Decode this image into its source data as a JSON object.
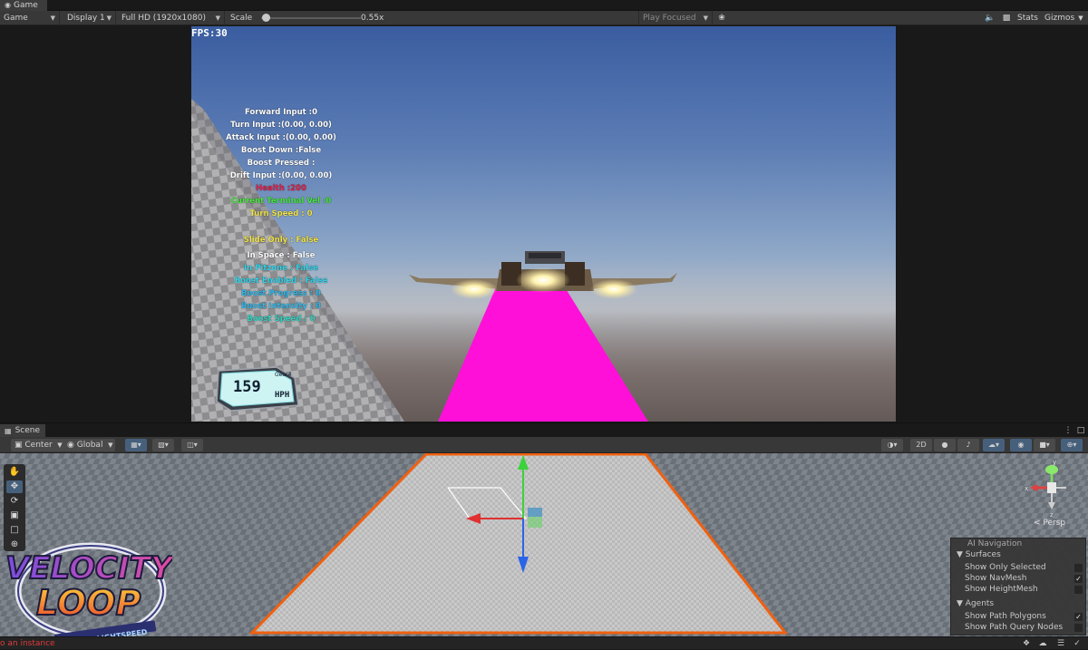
{
  "game_window": {
    "tab_label": "Game",
    "toolbar": {
      "mode": "Game",
      "display": "Display 1",
      "resolution": "Full HD (1920x1080)",
      "scale_label": "Scale",
      "scale_value": "0.55x",
      "scale_fraction": 0.05,
      "play_focused": "Play Focused",
      "stats": "Stats",
      "gizmos": "Gizmos"
    }
  },
  "hud": {
    "fps": "FPS:30",
    "lines": [
      {
        "text": "Forward Input :0",
        "color": "#ffffff"
      },
      {
        "text": "Turn Input :(0.00, 0.00)",
        "color": "#ffffff"
      },
      {
        "text": "Attack Input :(0.00, 0.00)",
        "color": "#ffffff"
      },
      {
        "text": "Boost Down :False",
        "color": "#ffffff"
      },
      {
        "text": "Boost Pressed :",
        "color": "#ffffff"
      },
      {
        "text": "Drift Input :(0.00, 0.00)",
        "color": "#ffffff"
      },
      {
        "text": "Health :200",
        "color": "#e0234a"
      },
      {
        "text": "Current Terminal Vel :0",
        "color": "#46e63c"
      },
      {
        "text": "Turn Speed : 0",
        "color": "#f0e34a"
      },
      {
        "text": "Slide Only : False",
        "color": "#f0e34a"
      },
      {
        "text": "In Space : False",
        "color": "#ffffff"
      },
      {
        "text": "In Pitzone : False",
        "color": "#33d3e8"
      },
      {
        "text": "Boost Enabled : False",
        "color": "#33d3e8"
      },
      {
        "text": "Boost Progress : 0",
        "color": "#33b7e8"
      },
      {
        "text": "Boost Intensity : 0",
        "color": "#33b7e8"
      },
      {
        "text": "Boost Speed : 0",
        "color": "#33d3c0"
      }
    ],
    "speedometer": {
      "speed": "159",
      "gear": "Gear4",
      "unit": "HPH"
    }
  },
  "scene_window": {
    "tab_label": "Scene",
    "toolbar": {
      "pivot": "Center",
      "space": "Global",
      "mode_2d": "2D"
    },
    "persp_label": "< Persp",
    "ai_navigation": {
      "title": "AI Navigation",
      "surfaces_label": "Surfaces",
      "surfaces": [
        {
          "label": "Show Only Selected",
          "checked": false
        },
        {
          "label": "Show NavMesh",
          "checked": true
        },
        {
          "label": "Show HeightMesh",
          "checked": false
        }
      ],
      "agents_label": "Agents",
      "agents": [
        {
          "label": "Show Path Polygons",
          "checked": true
        },
        {
          "label": "Show Path Query Nodes",
          "checked": false
        }
      ]
    },
    "logo": {
      "line1": "VELOCITY",
      "line2": "LOOP",
      "tagline": "ZERO TO LIGHTSPEED"
    }
  },
  "status_bar": {
    "message": "o an instance"
  },
  "colors": {
    "accent_selected": "#46607c",
    "error_text": "#e23b3b",
    "beam": "#ff10d8",
    "floor_outline": "#f06010"
  }
}
